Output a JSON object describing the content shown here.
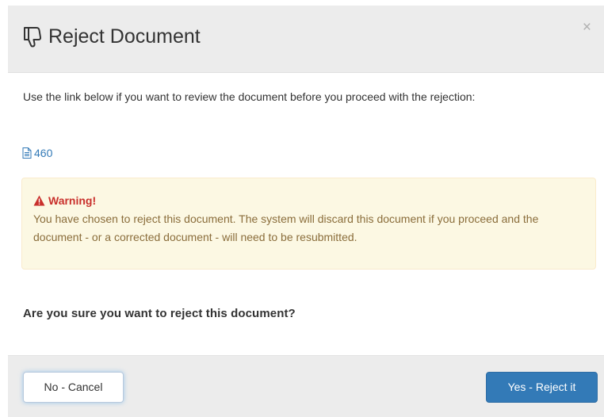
{
  "dialog": {
    "title": "Reject Document",
    "close_symbol": "×"
  },
  "body": {
    "intro_text": "Use the link below if you want to review the document before you proceed with the rejection:",
    "document_link": "460",
    "warning": {
      "title": "Warning!",
      "text": "You have chosen to reject this document. The system will discard this document if you proceed and the document - or a corrected document - will need to be resubmitted."
    },
    "question": "Are you sure you want to reject this document?"
  },
  "footer": {
    "cancel_label": "No - Cancel",
    "confirm_label": "Yes - Reject it"
  },
  "icons": {
    "title": "thumbs-down-icon",
    "document": "file-text-icon",
    "warning": "warning-triangle-icon",
    "close": "close-icon"
  },
  "colors": {
    "primary": "#337ab7",
    "warning_bg": "#fcf8e3",
    "warning_title": "#c9302c",
    "warning_text": "#8a6d3b",
    "header_bg": "#ececec"
  }
}
